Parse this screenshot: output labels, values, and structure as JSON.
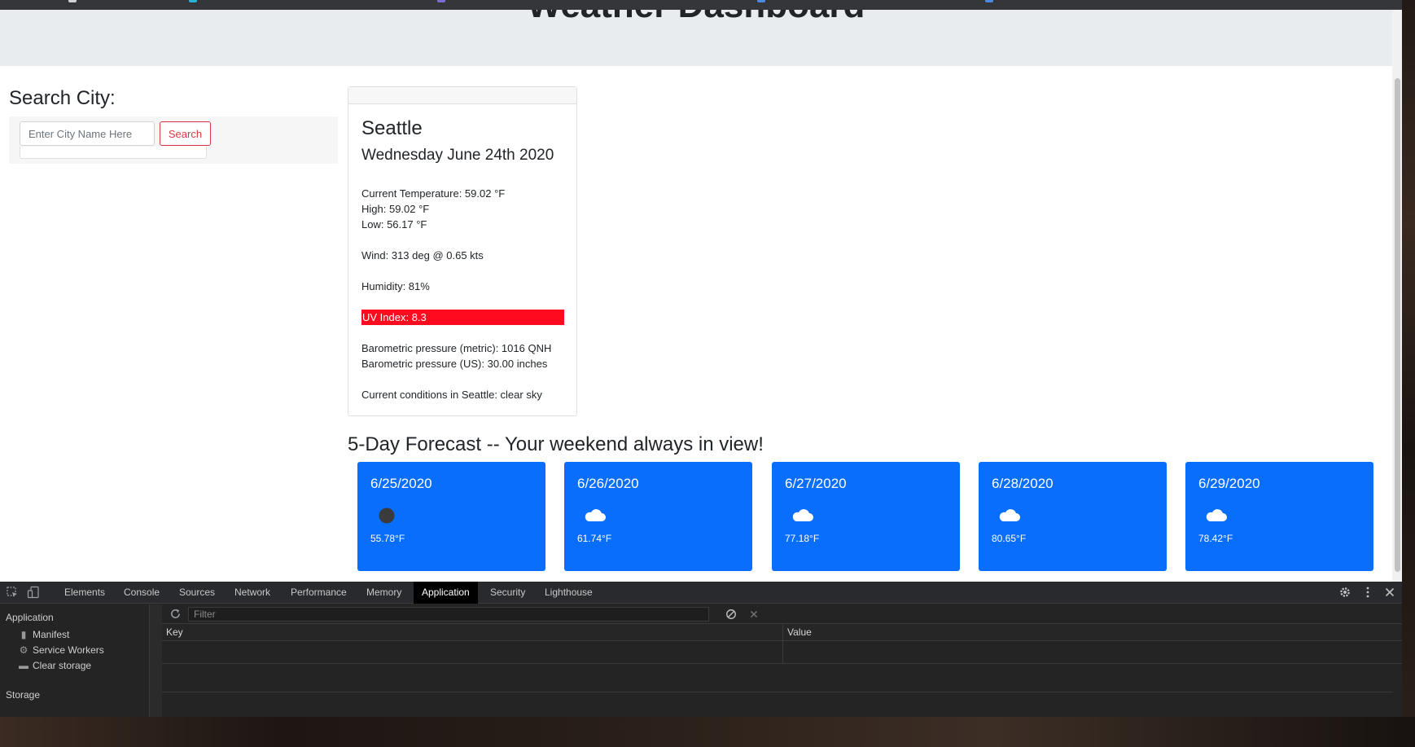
{
  "app": {
    "heading": "Weather Dashboard"
  },
  "search": {
    "title": "Search City:",
    "placeholder": "Enter City Name Here",
    "button_label": "Search"
  },
  "current": {
    "city": "Seattle",
    "date": "Wednesday June 24th 2020",
    "temperature": "Current Temperature: 59.02 °F",
    "high": "High: 59.02 °F",
    "low": "Low: 56.17 °F",
    "wind": "Wind: 313 deg @ 0.65 kts",
    "humidity": "Humidity: 81%",
    "uv": "UV Index: 8.3",
    "uv_color": "#ff0a1e",
    "pressure_metric": "Barometric pressure (metric): 1016 QNH",
    "pressure_us": "Barometric pressure (US): 30.00 inches",
    "conditions": "Current conditions in Seattle: clear sky"
  },
  "forecast": {
    "title": "5-Day Forecast -- Your weekend always in view!",
    "card_color": "#0a6efc",
    "days": [
      {
        "date": "6/25/2020",
        "icon": "clear-night-icon",
        "temp": "55.78°F"
      },
      {
        "date": "6/26/2020",
        "icon": "cloud-icon",
        "temp": "61.74°F"
      },
      {
        "date": "6/27/2020",
        "icon": "cloud-icon",
        "temp": "77.18°F"
      },
      {
        "date": "6/28/2020",
        "icon": "cloud-icon",
        "temp": "80.65°F"
      },
      {
        "date": "6/29/2020",
        "icon": "cloud-icon",
        "temp": "78.42°F"
      }
    ]
  },
  "devtools": {
    "tabs": [
      "Elements",
      "Console",
      "Sources",
      "Network",
      "Performance",
      "Memory",
      "Application",
      "Security",
      "Lighthouse"
    ],
    "active_tab": "Application",
    "sidebar": {
      "application_header": "Application",
      "items": [
        {
          "label": "Manifest",
          "icon": "file-icon"
        },
        {
          "label": "Service Workers",
          "icon": "gear-icon"
        },
        {
          "label": "Clear storage",
          "icon": "trash-icon"
        }
      ],
      "storage_header": "Storage"
    },
    "filter_placeholder": "Filter",
    "columns": {
      "key": "Key",
      "value": "Value"
    }
  }
}
